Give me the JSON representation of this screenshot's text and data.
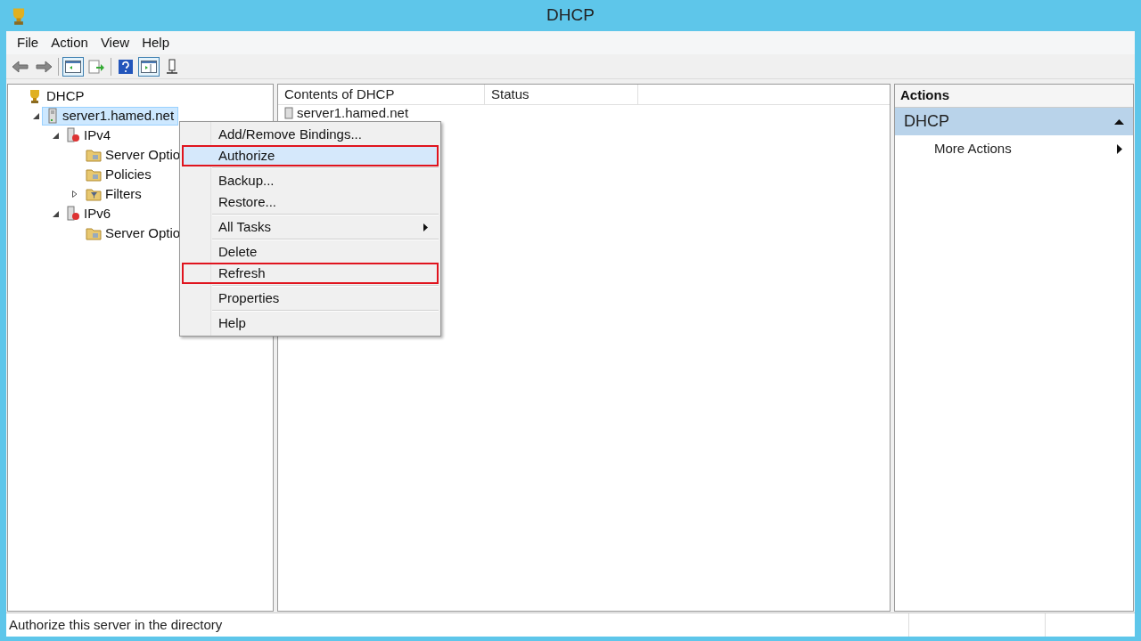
{
  "window": {
    "title": "DHCP"
  },
  "menu_bar": [
    "File",
    "Action",
    "View",
    "Help"
  ],
  "toolbar": [
    {
      "kind": "back",
      "disabled": false
    },
    {
      "kind": "forward",
      "disabled": false
    },
    {
      "kind": "pane",
      "selected": true
    },
    {
      "kind": "export",
      "selected": false
    },
    {
      "kind": "help",
      "selected": false
    },
    {
      "kind": "pane2",
      "selected": true
    },
    {
      "kind": "server",
      "selected": false
    }
  ],
  "tree": [
    {
      "label": "DHCP",
      "kind": "root",
      "selected": false,
      "children": [
        {
          "label": "server1.hamed.net",
          "kind": "server",
          "selected": true,
          "expanded": true,
          "children": [
            {
              "label": "IPv4",
              "kind": "ip",
              "selected": false,
              "expanded": true,
              "children": [
                {
                  "label": "Server Optio",
                  "kind": "folder",
                  "selected": false
                },
                {
                  "label": "Policies",
                  "kind": "folder",
                  "selected": false
                },
                {
                  "label": "Filters",
                  "kind": "filter",
                  "selected": false,
                  "expanded": false
                }
              ]
            },
            {
              "label": "IPv6",
              "kind": "ip",
              "selected": false,
              "expanded": true,
              "children": [
                {
                  "label": "Server Optio",
                  "kind": "folder",
                  "selected": false
                }
              ]
            }
          ]
        }
      ]
    }
  ],
  "list": {
    "columns": [
      "Contents of DHCP",
      "Status"
    ],
    "rows": [
      {
        "name": "server1.hamed.net"
      }
    ]
  },
  "context_menu": [
    {
      "kind": "item",
      "label": "Add/Remove Bindings...",
      "selected": false,
      "highlighted": false
    },
    {
      "kind": "item",
      "label": "Authorize",
      "selected": true,
      "highlighted": true
    },
    {
      "kind": "separator"
    },
    {
      "kind": "item",
      "label": "Backup...",
      "selected": false,
      "highlighted": false
    },
    {
      "kind": "item",
      "label": "Restore...",
      "selected": false,
      "highlighted": false
    },
    {
      "kind": "separator"
    },
    {
      "kind": "submenu",
      "label": "All Tasks",
      "selected": false,
      "highlighted": false
    },
    {
      "kind": "separator"
    },
    {
      "kind": "item",
      "label": "Delete",
      "selected": false,
      "highlighted": false
    },
    {
      "kind": "item",
      "label": "Refresh",
      "selected": false,
      "highlighted": true
    },
    {
      "kind": "separator"
    },
    {
      "kind": "item",
      "label": "Properties",
      "selected": false,
      "highlighted": false
    },
    {
      "kind": "separator"
    },
    {
      "kind": "item",
      "label": "Help",
      "selected": false,
      "highlighted": false
    }
  ],
  "actions": {
    "title": "Actions",
    "section": {
      "label": "DHCP",
      "expanded": true
    },
    "items": [
      {
        "label": "More Actions",
        "kind": "submenu"
      }
    ]
  },
  "status_bar": {
    "text": "Authorize this server in the directory"
  }
}
